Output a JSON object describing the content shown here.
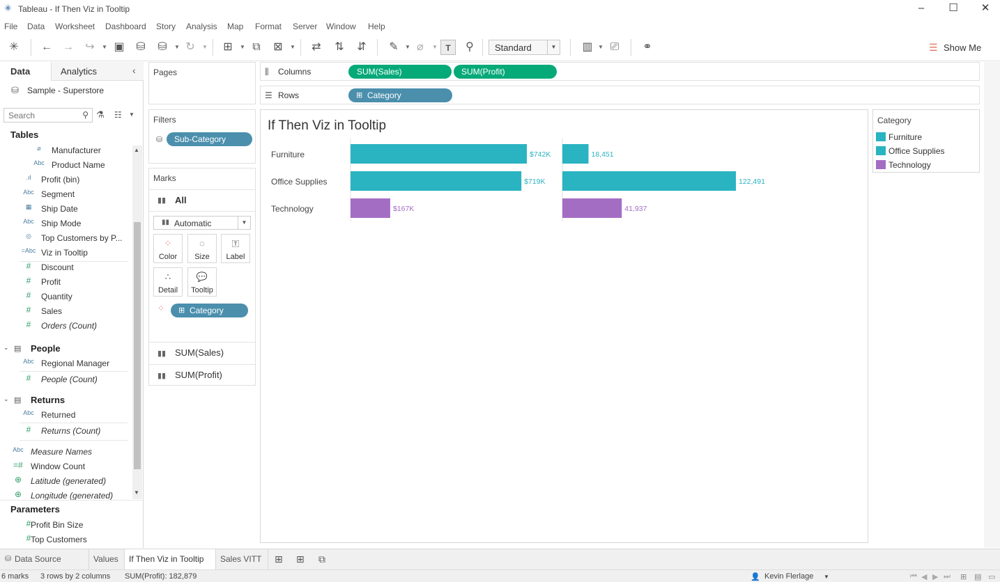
{
  "window": {
    "title": "Tableau - If Then Viz in Tooltip"
  },
  "menu": [
    "File",
    "Data",
    "Worksheet",
    "Dashboard",
    "Story",
    "Analysis",
    "Map",
    "Format",
    "Server",
    "Window",
    "Help"
  ],
  "toolbar": {
    "fit_value": "Standard",
    "show_me": "Show Me"
  },
  "datapane": {
    "tab_data": "Data",
    "tab_analytics": "Analytics",
    "source": "Sample - Superstore",
    "search_placeholder": "Search",
    "tables_header": "Tables",
    "fields": [
      {
        "label": "Manufacturer",
        "type": "clip",
        "italic": false
      },
      {
        "label": "Product Name",
        "type": "Abc",
        "italic": false
      },
      {
        "label": "Profit (bin)",
        "type": "bin",
        "italic": false
      },
      {
        "label": "Segment",
        "type": "Abc",
        "italic": false
      },
      {
        "label": "Ship Date",
        "type": "date",
        "italic": false
      },
      {
        "label": "Ship Mode",
        "type": "Abc",
        "italic": false
      },
      {
        "label": "Top Customers by P...",
        "type": "set",
        "italic": false
      },
      {
        "label": "Viz in Tooltip",
        "type": "=Abc",
        "italic": false
      },
      {
        "label": "Discount",
        "type": "#",
        "italic": false
      },
      {
        "label": "Profit",
        "type": "#",
        "italic": false
      },
      {
        "label": "Quantity",
        "type": "#",
        "italic": false
      },
      {
        "label": "Sales",
        "type": "#",
        "italic": false
      },
      {
        "label": "Orders (Count)",
        "type": "#",
        "italic": true
      }
    ],
    "people_header": "People",
    "people_fields": [
      {
        "label": "Regional Manager",
        "type": "Abc",
        "italic": false
      },
      {
        "label": "People (Count)",
        "type": "#",
        "italic": true
      }
    ],
    "returns_header": "Returns",
    "returns_fields": [
      {
        "label": "Returned",
        "type": "Abc",
        "italic": false
      },
      {
        "label": "Returns (Count)",
        "type": "#",
        "italic": true
      }
    ],
    "other_fields": [
      {
        "label": "Measure Names",
        "type": "Abc",
        "italic": true
      },
      {
        "label": "Window Count",
        "type": "=#",
        "italic": false
      },
      {
        "label": "Latitude (generated)",
        "type": "globe",
        "italic": true
      },
      {
        "label": "Longitude (generated)",
        "type": "globe",
        "italic": true
      }
    ],
    "parameters_header": "Parameters",
    "parameters": [
      {
        "label": "Profit Bin Size",
        "type": "#"
      },
      {
        "label": "Top Customers",
        "type": "#"
      }
    ]
  },
  "cards": {
    "pages": "Pages",
    "filters": "Filters",
    "filter_pill": "Sub-Category",
    "marks": "Marks",
    "marks_all": "All",
    "mark_type": "Automatic",
    "buttons": [
      "Color",
      "Size",
      "Label",
      "Detail",
      "Tooltip"
    ],
    "category_pill": "Category",
    "measures": [
      "SUM(Sales)",
      "SUM(Profit)"
    ]
  },
  "shelves": {
    "columns_label": "Columns",
    "columns_pills": [
      "SUM(Sales)",
      "SUM(Profit)"
    ],
    "rows_label": "Rows",
    "rows_pill": "Category"
  },
  "legend": {
    "title": "Category",
    "items": [
      {
        "label": "Furniture",
        "color": "#2ab3c1"
      },
      {
        "label": "Office Supplies",
        "color": "#2ab3c1"
      },
      {
        "label": "Technology",
        "color": "#a46dc4"
      }
    ]
  },
  "chart_data": {
    "type": "bar",
    "title": "If Then Viz in Tooltip",
    "categories": [
      "Furniture",
      "Office Supplies",
      "Technology"
    ],
    "colors": [
      "#2ab3c1",
      "#2ab3c1",
      "#a46dc4"
    ],
    "series": [
      {
        "name": "SUM(Sales)",
        "values": [
          742000,
          719000,
          167000
        ],
        "labels": [
          "$742K",
          "$719K",
          "$167K"
        ]
      },
      {
        "name": "SUM(Profit)",
        "values": [
          18451,
          122491,
          41937
        ],
        "labels": [
          "18,451",
          "122,491",
          "41,937"
        ]
      }
    ]
  },
  "sheet_tabs": {
    "data_source": "Data Source",
    "sheets": [
      "Values",
      "If Then Viz in Tooltip",
      "Sales VITT"
    ],
    "active_index": 1
  },
  "status": {
    "marks": "6 marks",
    "dims": "3 rows by 2 columns",
    "sum": "SUM(Profit): 182,879",
    "user": "Kevin Flerlage"
  }
}
